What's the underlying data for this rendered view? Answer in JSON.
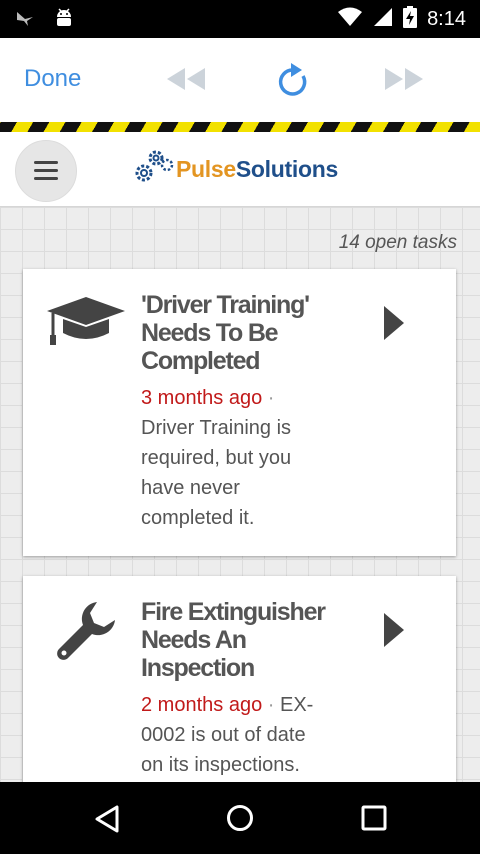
{
  "status_bar": {
    "time": "8:14",
    "icons": [
      "bird-notification-icon",
      "android-icon",
      "wifi-icon",
      "cell-signal-icon",
      "battery-charging-icon"
    ]
  },
  "toolbar": {
    "done_label": "Done",
    "icons": [
      "rewind-icon",
      "refresh-icon",
      "fast-forward-icon"
    ],
    "accent_color": "#3f8ee0"
  },
  "app_header": {
    "logo_part1": "Pulse",
    "logo_part2": "Solutions",
    "logo_colors": [
      "#e39522",
      "#1f4f8a"
    ]
  },
  "tasks": {
    "count_label": "14 open tasks",
    "items": [
      {
        "icon": "graduation-cap-icon",
        "title": "'Driver Training' Needs To Be Completed",
        "time_ago": "3 months ago",
        "separator": "·",
        "description": "Driver Training is required, but you have never completed it."
      },
      {
        "icon": "wrench-icon",
        "title": "Fire Extinguisher Needs An Inspection",
        "time_ago": "2 months ago",
        "separator": "·",
        "description": "EX-0002 is out of date on its inspections."
      }
    ]
  },
  "nav_bar": {
    "icons": [
      "back-icon",
      "home-icon",
      "recents-icon"
    ]
  }
}
